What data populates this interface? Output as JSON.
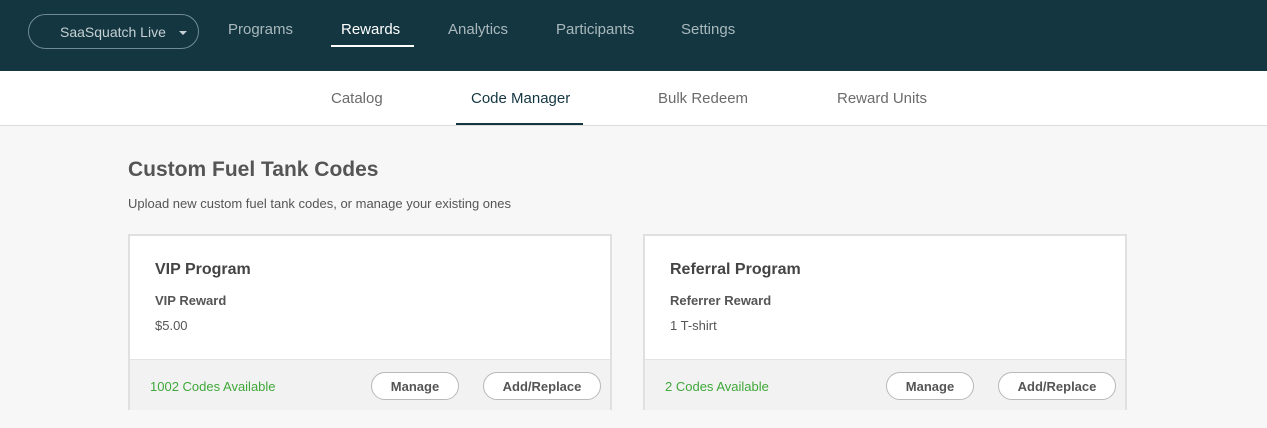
{
  "topbar": {
    "tenant_label": "SaaSquatch Live",
    "nav": [
      {
        "label": "Programs",
        "active": false
      },
      {
        "label": "Rewards",
        "active": true
      },
      {
        "label": "Analytics",
        "active": false
      },
      {
        "label": "Participants",
        "active": false
      },
      {
        "label": "Settings",
        "active": false
      }
    ],
    "background_color": "#143641"
  },
  "subnav": [
    {
      "label": "Catalog",
      "active": false
    },
    {
      "label": "Code Manager",
      "active": true
    },
    {
      "label": "Bulk Redeem",
      "active": false
    },
    {
      "label": "Reward Units",
      "active": false
    }
  ],
  "page": {
    "title": "Custom Fuel Tank Codes",
    "subtitle": "Upload new custom fuel tank codes, or manage your existing ones"
  },
  "cards": [
    {
      "program": "VIP Program",
      "reward": "VIP Reward",
      "value": "$5.00",
      "codes_available": "1002 Codes Available",
      "manage_label": "Manage",
      "add_label": "Add/Replace"
    },
    {
      "program": "Referral Program",
      "reward": "Referrer Reward",
      "value": "1 T-shirt",
      "codes_available": "2 Codes Available",
      "manage_label": "Manage",
      "add_label": "Add/Replace"
    }
  ],
  "colors": {
    "accent_green": "#3fa83a",
    "active_underline": "#143641"
  }
}
